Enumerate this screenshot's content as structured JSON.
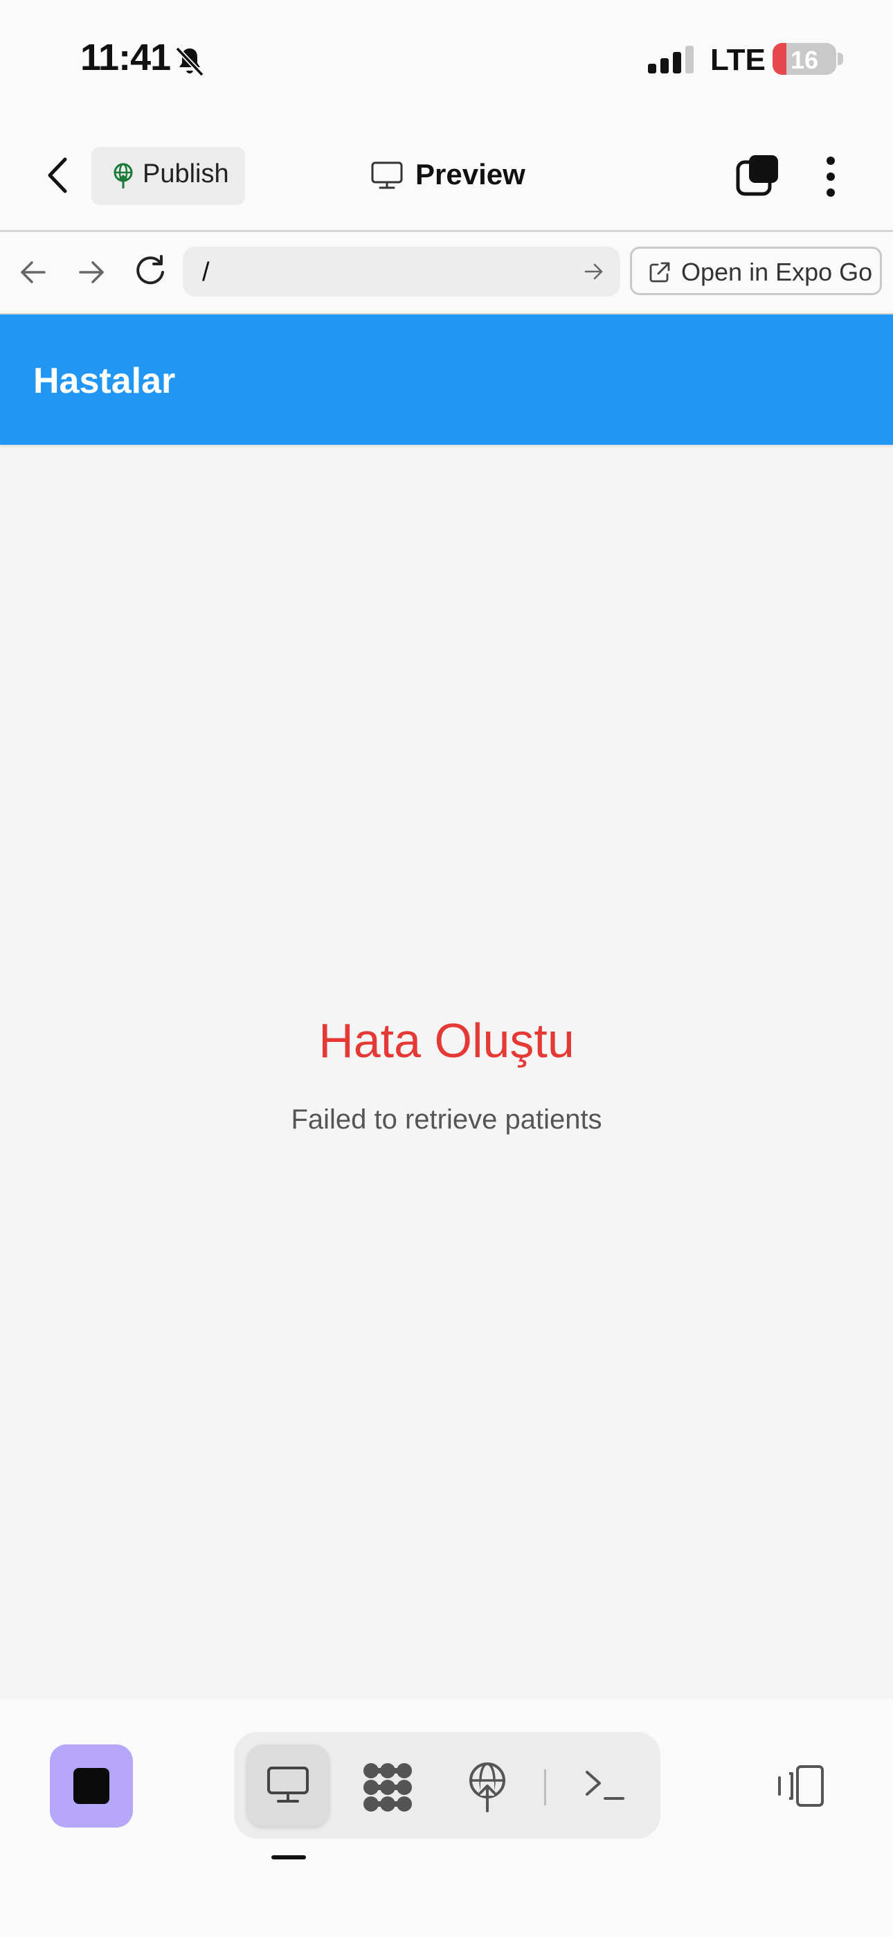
{
  "status_bar": {
    "time": "11:41",
    "network": "LTE",
    "battery": "16",
    "icons": [
      "bell-slash-icon",
      "signal-icon"
    ]
  },
  "toolbar": {
    "publish_label": "Publish",
    "preview_label": "Preview",
    "icons": [
      "chevron-left-icon",
      "globe-publish-icon",
      "monitor-icon",
      "windows-icon",
      "more-vertical-icon"
    ]
  },
  "browser": {
    "url": "/",
    "open_label": "Open in Expo Go",
    "icons": [
      "arrow-left-icon",
      "arrow-right-icon",
      "reload-icon",
      "arrow-go-icon",
      "external-link-icon"
    ]
  },
  "app": {
    "header_title": "Hastalar",
    "header_color": "#2196F3",
    "error_title": "Hata Oluştu",
    "error_color": "#E53935",
    "error_message": "Failed to retrieve patients"
  },
  "dock": {
    "stop_color": "#B7A7FB",
    "active_tab": "preview",
    "tabs": [
      "monitor-icon",
      "graph-icon",
      "globe-publish-icon",
      "terminal-icon"
    ],
    "icons": [
      "stop-icon",
      "device-toggle-icon"
    ]
  }
}
